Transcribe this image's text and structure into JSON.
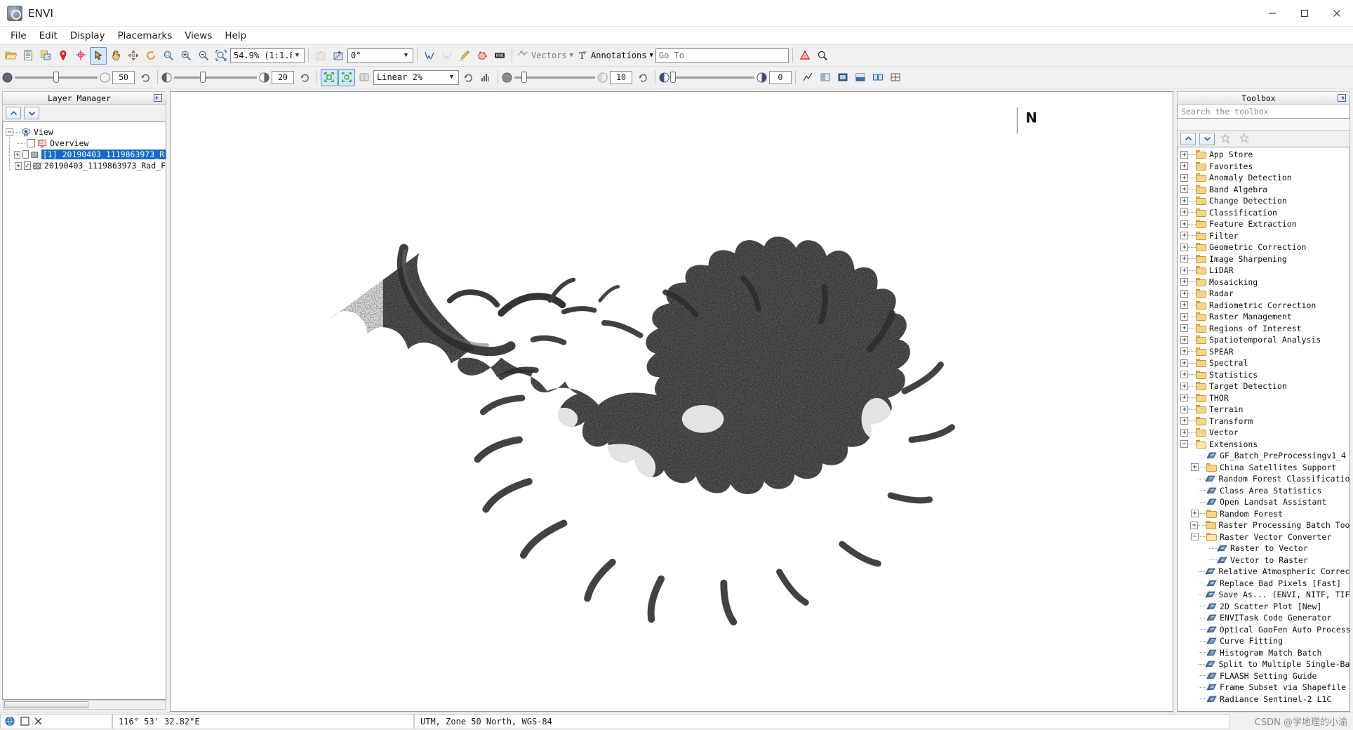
{
  "window": {
    "title": "ENVI",
    "app_icon": "envi-logo-icon",
    "controls": {
      "minimize": "minimize-icon",
      "maximize": "maximize-icon",
      "close": "close-icon"
    }
  },
  "menubar": {
    "items": [
      {
        "label": "File"
      },
      {
        "label": "Edit"
      },
      {
        "label": "Display"
      },
      {
        "label": "Placemarks"
      },
      {
        "label": "Views"
      },
      {
        "label": "Help"
      }
    ]
  },
  "toolbar_main": {
    "buttons": [
      {
        "name": "open-file-icon",
        "title": "Open"
      },
      {
        "name": "open-recent-icon",
        "title": "Open Recent"
      },
      {
        "name": "subset-raster-icon",
        "title": "Subset"
      },
      {
        "name": "placemark-icon",
        "title": "Placemark"
      },
      {
        "name": "crosshair-icon",
        "title": "Crosshair"
      },
      {
        "name": "select-arrow-icon",
        "title": "Select",
        "active": true
      },
      {
        "name": "pan-hand-icon",
        "title": "Pan"
      },
      {
        "name": "fly-icon",
        "title": "Fly"
      },
      {
        "name": "rotate-icon",
        "title": "Rotate"
      },
      {
        "name": "zoom-fit-icon",
        "title": "Zoom to Full Extent"
      },
      {
        "name": "zoom-in-icon",
        "title": "Zoom In"
      },
      {
        "name": "zoom-out-icon",
        "title": "Zoom Out"
      },
      {
        "name": "zoom-to-selection-icon",
        "title": "Zoom to Selection"
      }
    ],
    "zoom_combo": {
      "value": "54.9% (1:1.8",
      "arrow": "chevron-down-icon"
    },
    "chip_buttons": [
      {
        "name": "chip-north-up-icon",
        "disabled": true
      },
      {
        "name": "chip-rotate-north-icon",
        "disabled": false
      }
    ],
    "rotation_combo": {
      "value": "0°",
      "arrow": "chevron-down-icon"
    },
    "right_buttons": [
      {
        "name": "cursor-value-icon"
      },
      {
        "name": "spectral-profile-icon",
        "disabled": true
      },
      {
        "name": "region-of-interest-pencil-icon"
      },
      {
        "name": "roi-tool-icon"
      },
      {
        "name": "pixel-value-icon"
      }
    ],
    "vectors_menu": {
      "label": "Vectors",
      "icon": "vectors-icon",
      "caret": "chevron-down-icon",
      "disabled": true
    },
    "annotations_menu": {
      "label": "Annotations",
      "icon": "annotations-text-icon",
      "caret": "chevron-down-icon",
      "disabled": false
    },
    "goto": {
      "placeholder": "Go To",
      "value": "Go To"
    },
    "alert_icon": "alert-a-icon",
    "search_icon": "search-icon"
  },
  "toolbar_display": {
    "brightness": {
      "icon": "brightness-icon",
      "value": "50",
      "percent": 50,
      "reset_icon": "reset-icon"
    },
    "contrast": {
      "icon": "contrast-icon",
      "value": "20",
      "percent": 35,
      "reset_icon": "reset-icon"
    },
    "sharpen_toggles": [
      {
        "name": "stretch-on-view-icon",
        "active": true
      },
      {
        "name": "stretch-on-roi-icon",
        "active": true
      }
    ],
    "portal_icon": "portal-icon",
    "stretch_combo": {
      "value": "Linear 2%",
      "arrow": "chevron-down-icon"
    },
    "stretch_reset_icon": "reset-icon",
    "histogram_icon": "histogram-icon",
    "sharpness": {
      "icon": "sharpness-icon",
      "value": "10",
      "percent": 12,
      "reset_icon": "reset-icon"
    },
    "transparency": {
      "icon": "transparency-icon",
      "value": "0",
      "percent": 2
    },
    "right_buttons": [
      {
        "name": "chart-icon"
      },
      {
        "name": "image-swipe-icon"
      },
      {
        "name": "image-blend-icon"
      },
      {
        "name": "image-flicker-icon"
      },
      {
        "name": "image-link-icon"
      },
      {
        "name": "view-grid-icon"
      }
    ]
  },
  "layer_manager": {
    "title": "Layer Manager",
    "collapse_icon": "collapse-panel-icon",
    "toolbar": [
      {
        "name": "move-layer-up-button",
        "icon": "chevron-up-icon"
      },
      {
        "name": "move-layer-down-button",
        "icon": "chevron-down-icon"
      }
    ],
    "tree": [
      {
        "indent": 0,
        "expander": "minus",
        "icon": "view-eye-icon",
        "label": "View",
        "checkbox": null,
        "selected": false
      },
      {
        "indent": 1,
        "expander": "none",
        "icon": "overview-monitor-icon",
        "label": "Overview",
        "checkbox": false,
        "selected": false
      },
      {
        "indent": 1,
        "expander": "plus",
        "icon": "raster-layer-icon",
        "label": "[1] 20190403_1119863973_R",
        "checkbox": false,
        "selected": true
      },
      {
        "indent": 1,
        "expander": "plus",
        "icon": "raster-layer-icon",
        "label": "20190403_1119863973_Rad_F",
        "checkbox": true,
        "selected": false
      }
    ],
    "scrollbar": "horizontal-scrollbar"
  },
  "map_view": {
    "north_arrow_label": "N",
    "background": "#ffffff",
    "image_alt": "grayscale-reservoir-raster"
  },
  "toolbox": {
    "title": "Toolbox",
    "collapse_icon": "collapse-panel-icon",
    "search": {
      "placeholder": "Search the toolbox",
      "value": ""
    },
    "toolbar": [
      {
        "name": "move-up-button",
        "icon": "chevron-up-icon"
      },
      {
        "name": "move-down-button",
        "icon": "chevron-down-icon"
      },
      {
        "name": "add-favorite-button",
        "icon": "star-add-icon",
        "disabled": true
      },
      {
        "name": "remove-favorite-button",
        "icon": "star-remove-icon",
        "disabled": true
      }
    ],
    "tree": [
      {
        "indent": 0,
        "expander": "plus",
        "type": "folder",
        "label": "App Store"
      },
      {
        "indent": 0,
        "expander": "plus",
        "type": "folder-star",
        "label": "Favorites"
      },
      {
        "indent": 0,
        "expander": "plus",
        "type": "folder",
        "label": "Anomaly Detection"
      },
      {
        "indent": 0,
        "expander": "plus",
        "type": "folder",
        "label": "Band Algebra"
      },
      {
        "indent": 0,
        "expander": "plus",
        "type": "folder",
        "label": "Change Detection"
      },
      {
        "indent": 0,
        "expander": "plus",
        "type": "folder",
        "label": "Classification"
      },
      {
        "indent": 0,
        "expander": "plus",
        "type": "folder",
        "label": "Feature Extraction"
      },
      {
        "indent": 0,
        "expander": "plus",
        "type": "folder",
        "label": "Filter"
      },
      {
        "indent": 0,
        "expander": "plus",
        "type": "folder",
        "label": "Geometric Correction"
      },
      {
        "indent": 0,
        "expander": "plus",
        "type": "folder",
        "label": "Image Sharpening"
      },
      {
        "indent": 0,
        "expander": "plus",
        "type": "folder",
        "label": "LiDAR"
      },
      {
        "indent": 0,
        "expander": "plus",
        "type": "folder",
        "label": "Mosaicking"
      },
      {
        "indent": 0,
        "expander": "plus",
        "type": "folder",
        "label": "Radar"
      },
      {
        "indent": 0,
        "expander": "plus",
        "type": "folder",
        "label": "Radiometric Correction"
      },
      {
        "indent": 0,
        "expander": "plus",
        "type": "folder",
        "label": "Raster Management"
      },
      {
        "indent": 0,
        "expander": "plus",
        "type": "folder",
        "label": "Regions of Interest"
      },
      {
        "indent": 0,
        "expander": "plus",
        "type": "folder",
        "label": "Spatiotemporal Analysis"
      },
      {
        "indent": 0,
        "expander": "plus",
        "type": "folder",
        "label": "SPEAR"
      },
      {
        "indent": 0,
        "expander": "plus",
        "type": "folder",
        "label": "Spectral"
      },
      {
        "indent": 0,
        "expander": "plus",
        "type": "folder",
        "label": "Statistics"
      },
      {
        "indent": 0,
        "expander": "plus",
        "type": "folder",
        "label": "Target Detection"
      },
      {
        "indent": 0,
        "expander": "plus",
        "type": "folder",
        "label": "THOR"
      },
      {
        "indent": 0,
        "expander": "plus",
        "type": "folder",
        "label": "Terrain"
      },
      {
        "indent": 0,
        "expander": "plus",
        "type": "folder",
        "label": "Transform"
      },
      {
        "indent": 0,
        "expander": "plus",
        "type": "folder",
        "label": "Vector"
      },
      {
        "indent": 0,
        "expander": "minus",
        "type": "folder-open",
        "label": "Extensions"
      },
      {
        "indent": 1,
        "expander": "none",
        "type": "script",
        "label": "GF_Batch_PreProcessingv1_4"
      },
      {
        "indent": 1,
        "expander": "plus",
        "type": "folder",
        "label": "China Satellites Support"
      },
      {
        "indent": 1,
        "expander": "none",
        "type": "script",
        "label": "Random Forest Classification"
      },
      {
        "indent": 1,
        "expander": "none",
        "type": "script",
        "label": "Class Area Statistics"
      },
      {
        "indent": 1,
        "expander": "none",
        "type": "script",
        "label": "Open Landsat Assistant"
      },
      {
        "indent": 1,
        "expander": "plus",
        "type": "folder",
        "label": "Random Forest"
      },
      {
        "indent": 1,
        "expander": "plus",
        "type": "folder",
        "label": "Raster Processing Batch Tool"
      },
      {
        "indent": 1,
        "expander": "minus",
        "type": "folder-open",
        "label": "Raster Vector Converter"
      },
      {
        "indent": 2,
        "expander": "none",
        "type": "script",
        "label": "Raster to Vector"
      },
      {
        "indent": 2,
        "expander": "none",
        "type": "script",
        "label": "Vector to Raster"
      },
      {
        "indent": 1,
        "expander": "none",
        "type": "script",
        "label": "Relative Atmospheric Correct"
      },
      {
        "indent": 1,
        "expander": "none",
        "type": "script",
        "label": "Replace Bad Pixels [Fast]"
      },
      {
        "indent": 1,
        "expander": "none",
        "type": "script",
        "label": "Save As... (ENVI, NITF, TIFF"
      },
      {
        "indent": 1,
        "expander": "none",
        "type": "script",
        "label": "2D Scatter Plot [New]"
      },
      {
        "indent": 1,
        "expander": "none",
        "type": "script",
        "label": "ENVITask Code Generator"
      },
      {
        "indent": 1,
        "expander": "none",
        "type": "script",
        "label": "Optical GaoFen Auto Process"
      },
      {
        "indent": 1,
        "expander": "none",
        "type": "script",
        "label": "Curve Fitting"
      },
      {
        "indent": 1,
        "expander": "none",
        "type": "script",
        "label": "Histogram Match Batch"
      },
      {
        "indent": 1,
        "expander": "none",
        "type": "script",
        "label": "Split to Multiple Single-Ban"
      },
      {
        "indent": 1,
        "expander": "none",
        "type": "script",
        "label": "FLAASH Setting Guide"
      },
      {
        "indent": 1,
        "expander": "none",
        "type": "script",
        "label": "Frame Subset via Shapefile"
      },
      {
        "indent": 1,
        "expander": "none",
        "type": "script",
        "label": "Radiance Sentinel-2 L1C"
      }
    ]
  },
  "statusbar": {
    "left_icons": [
      {
        "name": "globe-status-icon"
      },
      {
        "name": "stop-status-icon"
      },
      {
        "name": "close-status-icon"
      }
    ],
    "coordinates": "116° 53' 32.82\"E",
    "projection": "UTM, Zone 50 North, WGS-84",
    "watermark": "CSDN @学地理的小渝"
  }
}
